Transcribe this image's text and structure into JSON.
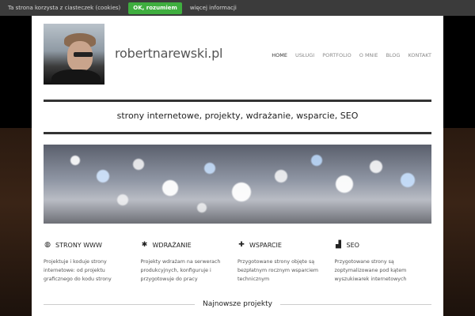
{
  "cookie_bar": {
    "message": "Ta strona korzysta z ciasteczek (cookies)",
    "accept_label": "OK, rozumiem",
    "more_label": "więcej informacji"
  },
  "header": {
    "logo_text": "robertnarewski.pl",
    "nav": [
      {
        "label": "HOME",
        "active": true
      },
      {
        "label": "USŁUGI"
      },
      {
        "label": "PORTFOLIO"
      },
      {
        "label": "O MNIE"
      },
      {
        "label": "BLOG"
      },
      {
        "label": "KONTAKT"
      }
    ]
  },
  "tagline": "strony internetowe, projekty, wdrażanie, wsparcie, SEO",
  "features": [
    {
      "icon": "globe-icon",
      "glyph": "◍",
      "title": "STRONY WWW",
      "text": "Projektuje i koduje strony internetowe: od projektu graficznego do kodu strony"
    },
    {
      "icon": "gear-icon",
      "glyph": "✱",
      "title": "WDRAŻANIE",
      "text": "Projekty wdrażam na serwerach produkcyjnych, konfiguruje i przygotowuje do pracy"
    },
    {
      "icon": "medkit-icon",
      "glyph": "✚",
      "title": "WSPARCIE",
      "text": "Przygotowane strony objęte są bezpłatnym rocznym wsparciem technicznym"
    },
    {
      "icon": "chart-icon",
      "glyph": "▟",
      "title": "SEO",
      "text": "Przygotowane strony są zoptymalizowane pod kątem wyszukiwarek internetowych"
    }
  ],
  "latest_projects": "Najnowsze projekty",
  "colors": {
    "accept": "#3fae3f",
    "cookie_bar": "#3b3b3b",
    "rule": "#333333"
  }
}
